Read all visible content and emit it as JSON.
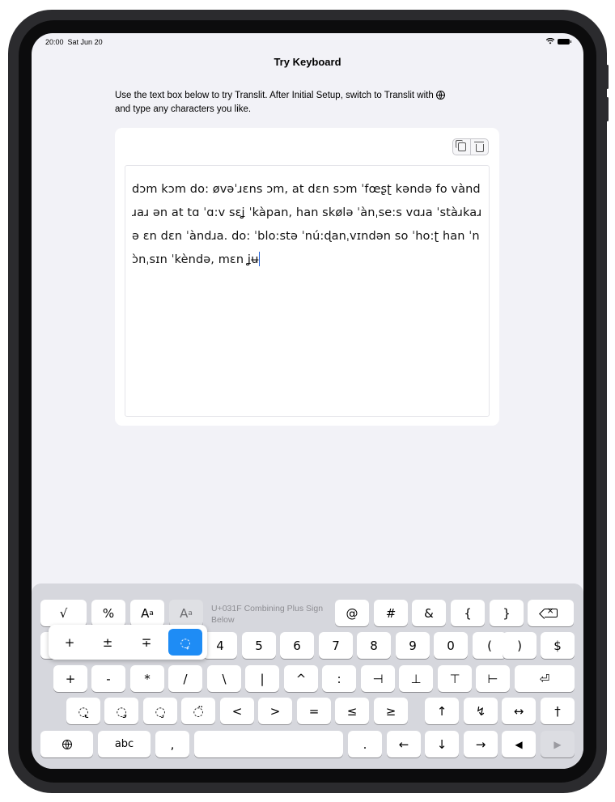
{
  "status_bar": {
    "time": "20:00",
    "date": "Sat Jun 20",
    "wifi_icon": "wifi-icon",
    "battery_icon": "battery-icon"
  },
  "header": {
    "title": "Try Keyboard"
  },
  "instructions": {
    "line1": "Use the text box below to try Translit. After Initial Setup, switch to Translit with",
    "line2": "and type any characters you like."
  },
  "editor": {
    "copy_icon": "copy-icon",
    "trash_icon": "trash-icon",
    "text": "dɔm kɔm do: øvəˈɹɛns ɔm, at dɛn sɔm ˈfœʂʈ kəndə fo vàndɹaɹ ən at tɑ ˈɑ:v sɛʝ ˈkàpan, han skølə ˈànˌse:s vɑɹa ˈstàɹkaɹə ɛn dɛn ˈàndɹa. do: ˈblo:stə ˈnú:ɖanˌvɪndən so ˈho:ʈ han ˈnɔ̀nˌsɪn ˈkèndə, mɛn ʝ",
    "text_tail": "ʉ"
  },
  "keyboard": {
    "hint": "U+031F Combining Plus Sign Below",
    "row1": [
      "√",
      "%",
      "@",
      "#",
      "&",
      "{",
      "}"
    ],
    "popup": [
      "+",
      "±",
      "∓",
      "̟"
    ],
    "row2": [
      "4",
      "5",
      "6",
      "7",
      "8",
      "9",
      "0",
      "(",
      ")",
      "$"
    ],
    "row3": [
      "+",
      "-",
      "*",
      "/",
      "\\",
      "|",
      "^",
      ":",
      "⊣",
      "⊥",
      "⊤",
      "⊢"
    ],
    "row4": [
      "̢",
      "̡",
      "̧",
      "̈",
      "<",
      ">",
      "=",
      "≤",
      "≥",
      "↑",
      "↯",
      "↔",
      "†"
    ],
    "row5": {
      "abc": "abc",
      "comma": ",",
      "period": ".",
      "left": "←",
      "down": "↓",
      "right": "→",
      "play_back": "◀",
      "play_fwd": "▶"
    },
    "return_symbol": "⏎"
  }
}
